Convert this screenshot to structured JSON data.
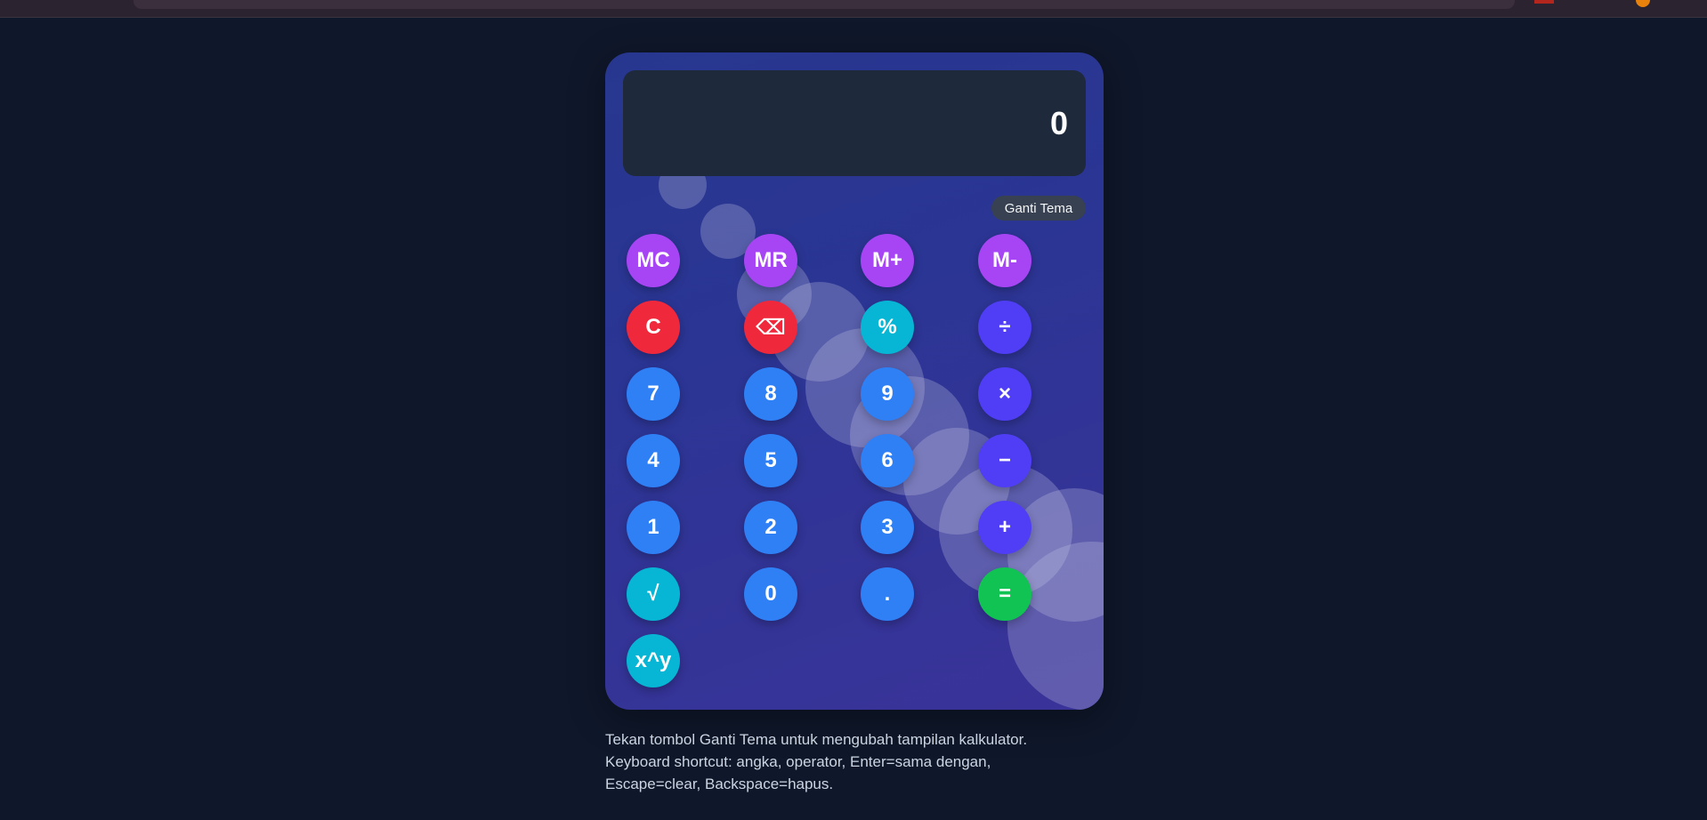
{
  "display": {
    "value": "0"
  },
  "theme_button": {
    "label": "Ganti Tema"
  },
  "keys": {
    "mc": "MC",
    "mr": "MR",
    "mplus": "M+",
    "mminus": "M-",
    "c": "C",
    "backspace": "⌫",
    "percent": "%",
    "divide": "÷",
    "seven": "7",
    "eight": "8",
    "nine": "9",
    "multiply": "×",
    "four": "4",
    "five": "5",
    "six": "6",
    "minus": "−",
    "one": "1",
    "two": "2",
    "three": "3",
    "plus": "+",
    "sqrt": "√",
    "zero": "0",
    "dot": ".",
    "equals": "=",
    "power": "x^y"
  },
  "colors": {
    "memory": "#a745f5",
    "clear": "#f0283c",
    "function": "#06b6d4",
    "operator": "#4f3ef5",
    "number": "#2f7ff5",
    "equals": "#10c353"
  },
  "help_text": {
    "line1": "Tekan tombol Ganti Tema untuk mengubah tampilan kalkulator.",
    "line2": "Keyboard shortcut: angka, operator, Enter=sama dengan,",
    "line3": "Escape=clear, Backspace=hapus."
  }
}
